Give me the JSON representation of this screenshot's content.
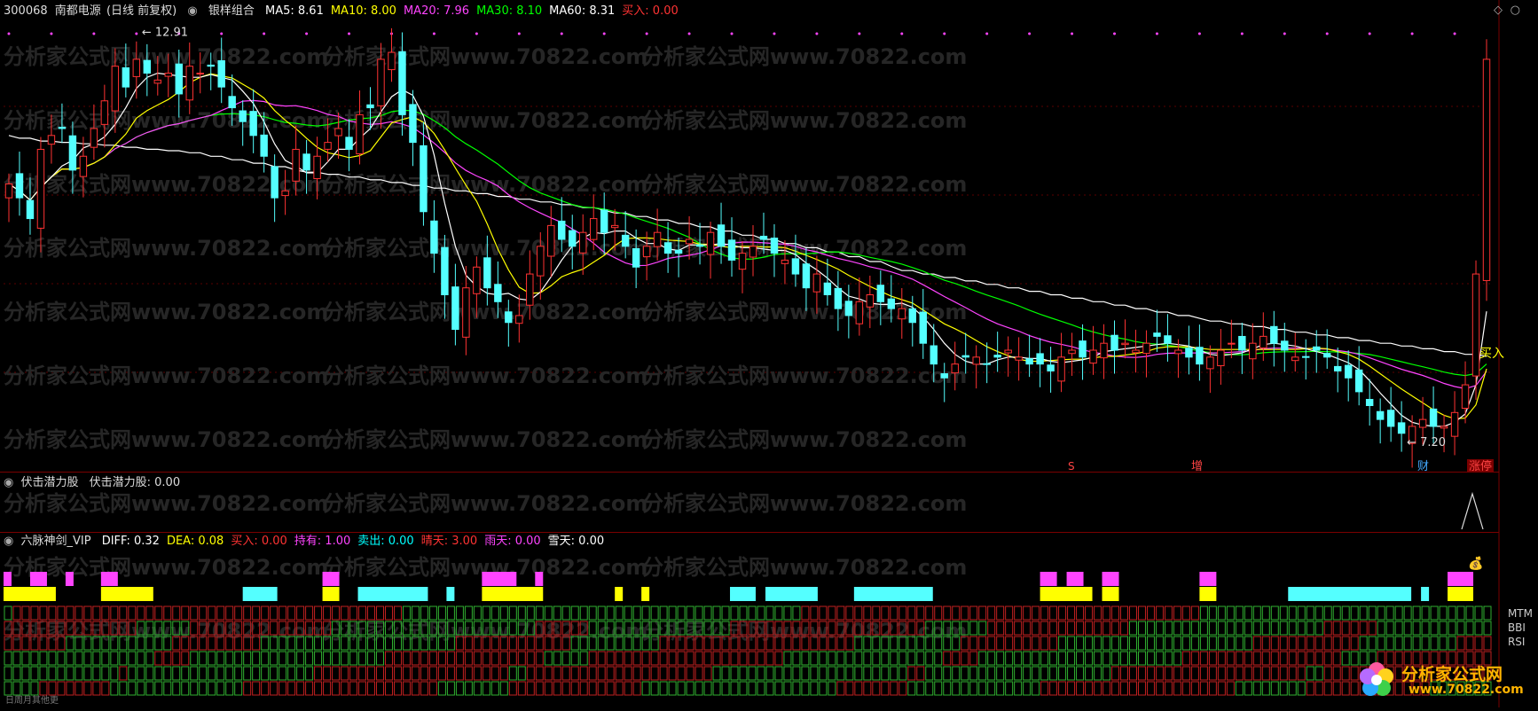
{
  "main_header": {
    "code": "300068",
    "name": "南都电源",
    "period": "(日线 前复权)",
    "indicator": "银样组合",
    "ma": [
      {
        "label": "MA5: 8.61",
        "color": "#ffffff"
      },
      {
        "label": "MA10: 8.00",
        "color": "#ffff00"
      },
      {
        "label": "MA20: 7.96",
        "color": "#ff44ff"
      },
      {
        "label": "MA30: 8.10",
        "color": "#00ff00"
      },
      {
        "label": "MA60: 8.31",
        "color": "#ffffff"
      },
      {
        "label": "买入: 0.00",
        "color": "#ff3333"
      }
    ]
  },
  "panel2_header": {
    "name": "伏击潜力股",
    "value": "伏击潜力股: 0.00"
  },
  "panel3_header": {
    "name": "六脉神剑_VIP",
    "items": [
      {
        "label": "DIFF: 0.32",
        "color": "#ffffff"
      },
      {
        "label": "DEA: 0.08",
        "color": "#ffff00"
      },
      {
        "label": "买入: 0.00",
        "color": "#ff3333"
      },
      {
        "label": "持有: 1.00",
        "color": "#ff44ff"
      },
      {
        "label": "卖出: 0.00",
        "color": "#00ffff"
      },
      {
        "label": "晴天: 3.00",
        "color": "#ff3333"
      },
      {
        "label": "雨天: 0.00",
        "color": "#ff44ff"
      },
      {
        "label": "雪天: 0.00",
        "color": "#ffffff"
      }
    ]
  },
  "annotations": {
    "high_label": "12.91",
    "low_label": "7.20",
    "buy_label": "买入",
    "marker_s": "S",
    "marker_zeng": "增",
    "marker_cai": "财",
    "marker_zhangting": "涨停"
  },
  "right_legend": [
    "MTM",
    "BBI",
    "RSI"
  ],
  "bottom_label": "日周月其他更",
  "watermark": "分析家公式网www.70822.com",
  "logo": {
    "text": "分析家公式网",
    "url": "www.70822.com"
  },
  "chart_data": {
    "type": "candlestick",
    "ylim": [
      6.8,
      13.2
    ],
    "up_color": "#ff3232",
    "down_color": "#54ffff",
    "ma_colors": {
      "ma5": "#ffffff",
      "ma10": "#ffff00",
      "ma20": "#ff44ff",
      "ma30": "#00ff00",
      "ma60": "#ffffff"
    },
    "closes": [
      10.8,
      10.6,
      10.3,
      11.3,
      11.5,
      11.6,
      11.0,
      11.2,
      11.6,
      12.0,
      12.5,
      12.2,
      12.6,
      12.4,
      12.3,
      12.4,
      12.1,
      12.5,
      12.4,
      12.5,
      12.2,
      11.9,
      11.7,
      11.5,
      11.2,
      10.6,
      10.7,
      11.3,
      11.0,
      11.2,
      11.4,
      11.6,
      11.3,
      11.8,
      11.9,
      12.6,
      12.7,
      11.8,
      11.4,
      10.4,
      9.8,
      9.2,
      8.7,
      9.3,
      9.6,
      9.3,
      9.1,
      8.8,
      8.9,
      9.5,
      9.9,
      10.2,
      10.0,
      9.9,
      10.1,
      10.3,
      10.1,
      10.2,
      9.9,
      9.6,
      9.9,
      10.1,
      9.8,
      9.8,
      10.0,
      9.9,
      10.1,
      9.9,
      9.7,
      9.8,
      9.9,
      10.0,
      9.8,
      9.7,
      9.5,
      9.3,
      9.5,
      9.2,
      9.0,
      8.9,
      9.1,
      9.2,
      9.1,
      9.0,
      9.0,
      8.8,
      8.5,
      8.2,
      8.0,
      8.2,
      8.3,
      8.3,
      8.2,
      8.3,
      8.4,
      8.3,
      8.2,
      8.2,
      8.1,
      8.3,
      8.4,
      8.3,
      8.4,
      8.5,
      8.4,
      8.5,
      8.4,
      8.5,
      8.6,
      8.5,
      8.4,
      8.3,
      8.2,
      8.3,
      8.4,
      8.5,
      8.4,
      8.5,
      8.6,
      8.5,
      8.4,
      8.3,
      8.3,
      8.4,
      8.3,
      8.1,
      8.0,
      7.8,
      7.6,
      7.4,
      7.3,
      7.2,
      7.3,
      7.4,
      7.3,
      7.3,
      7.5,
      7.9,
      9.5,
      12.6
    ],
    "ma60": [
      11.5,
      11.46,
      11.42,
      11.4,
      11.38,
      11.36,
      11.33,
      11.3,
      11.28,
      11.25,
      11.2,
      11.15,
      11.1,
      11.05,
      11.0,
      10.97,
      10.94,
      10.9,
      10.86,
      10.82,
      10.78,
      10.74,
      10.7,
      10.66,
      10.62,
      10.58,
      10.54,
      10.5,
      10.46,
      10.42,
      10.38,
      10.33,
      10.28,
      10.23,
      10.18,
      10.12,
      10.06,
      10.0,
      9.94,
      9.88,
      9.82,
      9.75,
      9.68,
      9.61,
      9.55,
      9.5,
      9.45,
      9.4,
      9.35,
      9.3,
      9.25,
      9.2,
      9.15,
      9.1,
      9.05,
      9.0,
      8.95,
      8.9,
      8.86,
      8.82,
      8.78,
      8.74,
      8.7,
      8.66,
      8.62,
      8.58,
      8.54,
      8.5,
      8.46,
      8.42,
      8.38,
      8.34,
      8.31
    ]
  }
}
